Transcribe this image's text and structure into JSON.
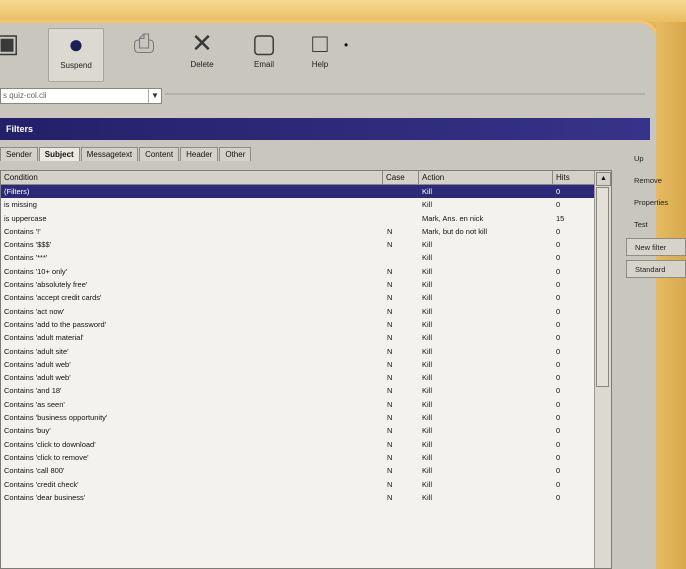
{
  "toolbar": {
    "buttons": [
      {
        "label": "",
        "icon": "window-icon"
      },
      {
        "label": "Suspend",
        "icon": "globe-icon"
      },
      {
        "label": "",
        "icon": "printer-icon"
      },
      {
        "label": "Delete",
        "icon": "x-icon"
      },
      {
        "label": "Email",
        "icon": "mail-icon"
      },
      {
        "label": "Help",
        "icon": "help-icon"
      }
    ]
  },
  "address": {
    "value": "s quiz-col.cli"
  },
  "window": {
    "title": "Filters"
  },
  "tabs": [
    "Sender",
    "Subject",
    "Messagetext",
    "Content",
    "Header",
    "Other"
  ],
  "table": {
    "headers": [
      "Condition",
      "Case",
      "Action",
      "Hits"
    ],
    "rows": [
      [
        "(Filters)",
        "",
        "Kill",
        "0"
      ],
      [
        "is missing",
        "",
        "Kill",
        "0"
      ],
      [
        "is uppercase",
        "",
        "Mark, Ans. en nick",
        "15"
      ],
      [
        "Contains '!'",
        "N",
        "Mark, but do not kill",
        "0"
      ],
      [
        "Contains '$$$'",
        "N",
        "Kill",
        "0"
      ],
      [
        "Contains '***'",
        "",
        "Kill",
        "0"
      ],
      [
        "Contains '10+ only'",
        "N",
        "Kill",
        "0"
      ],
      [
        "Contains 'absolutely free'",
        "N",
        "Kill",
        "0"
      ],
      [
        "Contains 'accept credit cards'",
        "N",
        "Kill",
        "0"
      ],
      [
        "Contains 'act now'",
        "N",
        "Kill",
        "0"
      ],
      [
        "Contains 'add to the password'",
        "N",
        "Kill",
        "0"
      ],
      [
        "Contains 'adult material'",
        "N",
        "Kill",
        "0"
      ],
      [
        "Contains 'adult site'",
        "N",
        "Kill",
        "0"
      ],
      [
        "Contains 'adult web'",
        "N",
        "Kill",
        "0"
      ],
      [
        "Contains 'adult web'",
        "N",
        "Kill",
        "0"
      ],
      [
        "Contains 'and 18'",
        "N",
        "Kill",
        "0"
      ],
      [
        "Contains 'as seen'",
        "N",
        "Kill",
        "0"
      ],
      [
        "Contains 'business opportunity'",
        "N",
        "Kill",
        "0"
      ],
      [
        "Contains 'buy'",
        "N",
        "Kill",
        "0"
      ],
      [
        "Contains 'click to download'",
        "N",
        "Kill",
        "0"
      ],
      [
        "Contains 'click to remove'",
        "N",
        "Kill",
        "0"
      ],
      [
        "Contains 'call 800'",
        "N",
        "Kill",
        "0"
      ],
      [
        "Contains 'credit check'",
        "N",
        "Kill",
        "0"
      ],
      [
        "Contains 'dear business'",
        "N",
        "Kill",
        "0"
      ]
    ]
  },
  "side": {
    "buttons": [
      "Up",
      "Remove",
      "Properties",
      "Test",
      "New filter",
      "Standard"
    ]
  },
  "colors": {
    "selection": "#2e2a7a",
    "titlebar": "#23206a",
    "frame": "#e2b55a"
  }
}
